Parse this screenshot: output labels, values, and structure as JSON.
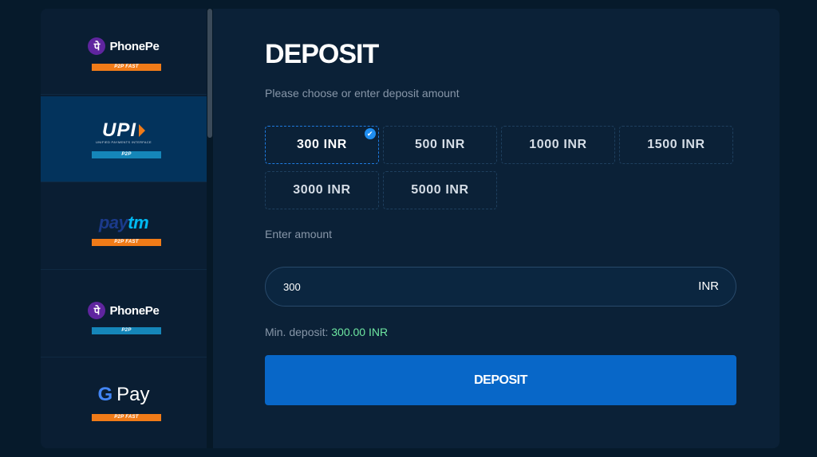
{
  "sidebar": {
    "methods": [
      {
        "logo_text": "PhonePe",
        "logo_glyph": "पे",
        "tag": "P2P FAST",
        "tag_color": "#f07b18",
        "active": false
      },
      {
        "logo_text": "UPI",
        "logo_sub": "UNIFIED PAYMENTS INTERFACE",
        "tag": "P2P",
        "tag_color": "#1586b9",
        "active": true
      },
      {
        "logo_pay": "pay",
        "logo_tm": "tm",
        "tag": "P2P FAST",
        "tag_color": "#f07b18",
        "active": false
      },
      {
        "logo_text": "PhonePe",
        "logo_glyph": "पे",
        "tag": "P2P",
        "tag_color": "#1586b9",
        "active": false
      },
      {
        "logo_g": "G",
        "logo_text": "Pay",
        "tag": "P2P FAST",
        "tag_color": "#f07b18",
        "active": false
      }
    ]
  },
  "main": {
    "title": "DEPOSIT",
    "subtitle": "Please choose or enter deposit amount",
    "amounts": [
      "300 INR",
      "500 INR",
      "1000 INR",
      "1500 INR",
      "3000 INR",
      "5000 INR"
    ],
    "selected_amount": "300 INR",
    "enter_label": "Enter amount",
    "input_value": "300",
    "currency": "INR",
    "min_label": "Min. deposit:",
    "min_value": "300.00 INR",
    "deposit_button": "DEPOSIT"
  },
  "colors": {
    "accent": "#0867c8",
    "min_value": "#6ee7a1",
    "tag_orange": "#f07b18",
    "tag_blue": "#1586b9"
  }
}
